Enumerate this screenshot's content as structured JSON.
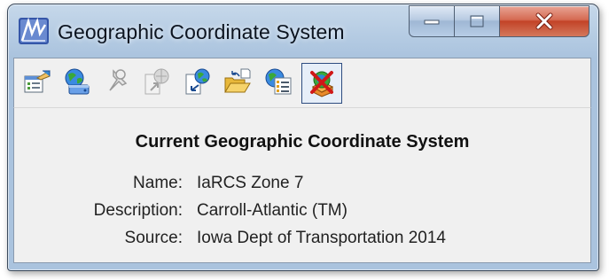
{
  "window": {
    "title": "Geographic Coordinate System",
    "controls": [
      "minimize-icon",
      "maximize-icon",
      "close-icon"
    ]
  },
  "toolbar": {
    "buttons": [
      {
        "icon": "select-from-library-icon",
        "enabled": true
      },
      {
        "icon": "globe-database-icon",
        "enabled": true
      },
      {
        "icon": "pushpin-icon",
        "enabled": false
      },
      {
        "icon": "export-globe-icon",
        "enabled": false
      },
      {
        "icon": "import-globe-icon",
        "enabled": true
      },
      {
        "icon": "open-folder-icon",
        "enabled": true
      },
      {
        "icon": "properties-globe-icon",
        "enabled": true
      },
      {
        "icon": "delete-gcs-icon",
        "enabled": true,
        "pressed": true
      }
    ]
  },
  "content": {
    "heading": "Current Geographic Coordinate System",
    "fields": [
      {
        "label": "Name:",
        "value": "IaRCS Zone 7"
      },
      {
        "label": "Description:",
        "value": "Carroll-Atlantic (TM)"
      },
      {
        "label": "Source:",
        "value": "Iowa Dept of Transportation 2014"
      }
    ]
  },
  "colors": {
    "title_bar": "#b3cae2",
    "close_button": "#c24327",
    "panel_background": "#f0f0f0"
  }
}
